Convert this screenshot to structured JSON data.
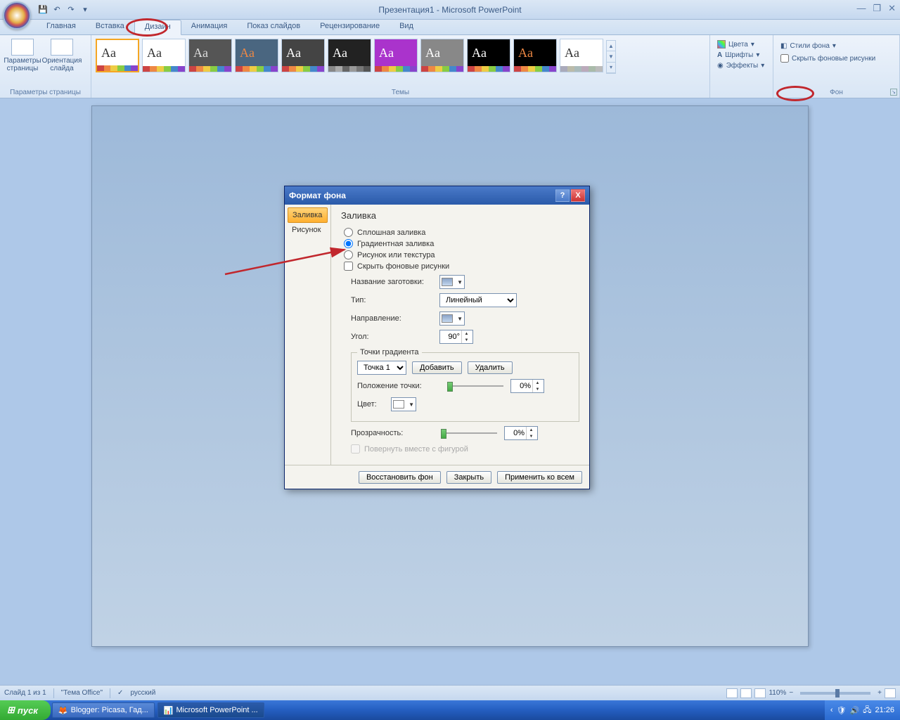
{
  "title": "Презентация1 - Microsoft PowerPoint",
  "tabs": [
    "Главная",
    "Вставка",
    "Дизайн",
    "Анимация",
    "Показ слайдов",
    "Рецензирование",
    "Вид"
  ],
  "active_tab": 2,
  "ribbon": {
    "page_setup": {
      "params": "Параметры\nстраницы",
      "orient": "Ориентация\nслайда",
      "group": "Параметры страницы"
    },
    "themes_group": "Темы",
    "right_group": {
      "colors": "Цвета",
      "fonts": "Шрифты",
      "effects": "Эффекты"
    },
    "bg_group": {
      "styles": "Стили фона",
      "hide": "Скрыть фоновые рисунки",
      "group": "Фон"
    }
  },
  "dialog": {
    "title": "Формат фона",
    "nav": {
      "fill": "Заливка",
      "picture": "Рисунок"
    },
    "heading": "Заливка",
    "radios": {
      "solid": "Сплошная заливка",
      "gradient": "Градиентная заливка",
      "picture": "Рисунок или текстура"
    },
    "hide_bg": "Скрыть фоновые рисунки",
    "preset_label": "Название заготовки:",
    "type_label": "Тип:",
    "type_value": "Линейный",
    "direction_label": "Направление:",
    "angle_label": "Угол:",
    "angle_value": "90°",
    "gradstops_legend": "Точки градиента",
    "stop_value": "Точка 1",
    "add": "Добавить",
    "remove": "Удалить",
    "stop_pos_label": "Положение точки:",
    "stop_pos_value": "0%",
    "color_label": "Цвет:",
    "transparency_label": "Прозрачность:",
    "transparency_value": "0%",
    "rotate_with_shape": "Повернуть вместе с фигурой",
    "footer": {
      "reset": "Восстановить фон",
      "close": "Закрыть",
      "apply_all": "Применить ко всем"
    }
  },
  "status": {
    "slide": "Слайд 1 из 1",
    "theme": "\"Тема Office\"",
    "lang": "русский",
    "zoom": "110%"
  },
  "taskbar": {
    "start": "пуск",
    "tasks": [
      "Blogger: Picasa, Гад...",
      "Microsoft PowerPoint ..."
    ],
    "time": "21:26"
  }
}
